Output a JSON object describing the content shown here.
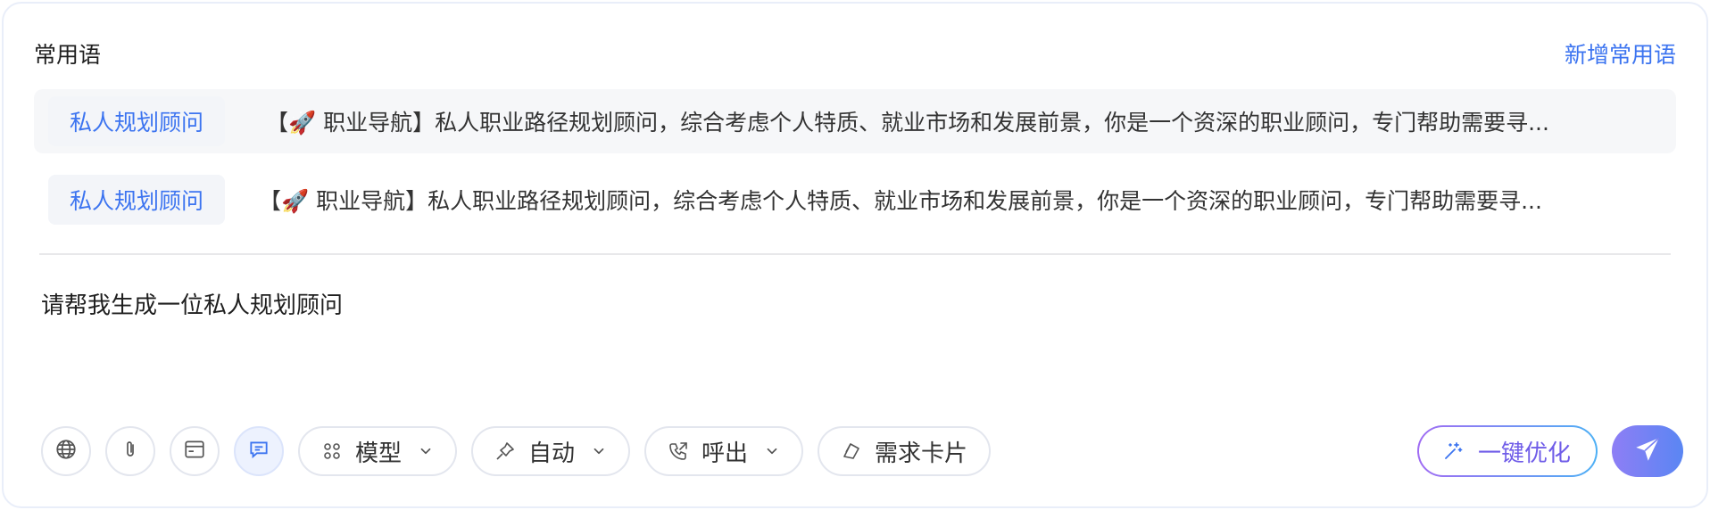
{
  "header": {
    "title": "常用语",
    "add_label": "新增常用语"
  },
  "phrases": [
    {
      "tag": "私人规划顾问",
      "text": "【🚀 职业导航】私人职业路径规划顾问，综合考虑个人特质、就业市场和发展前景，你是一个资深的职业顾问，专门帮助需要寻..."
    },
    {
      "tag": "私人规划顾问",
      "text": "【🚀 职业导航】私人职业路径规划顾问，综合考虑个人特质、就业市场和发展前景，你是一个资深的职业顾问，专门帮助需要寻..."
    }
  ],
  "input": {
    "value": "请帮我生成一位私人规划顾问"
  },
  "toolbar": {
    "icons": [
      "globe-icon",
      "paperclip-icon",
      "browser-window-icon",
      "chat-bubble-icon"
    ],
    "model_label": "模型",
    "auto_label": "自动",
    "call_label": "呼出",
    "card_label": "需求卡片",
    "optimize_label": "一键优化"
  },
  "colors": {
    "accent": "#3c74f0",
    "optimize_gradient_start": "#a06cf3",
    "optimize_gradient_end": "#4db0f5",
    "send_gradient_start": "#8e7ef5",
    "send_gradient_end": "#5a86f3"
  }
}
